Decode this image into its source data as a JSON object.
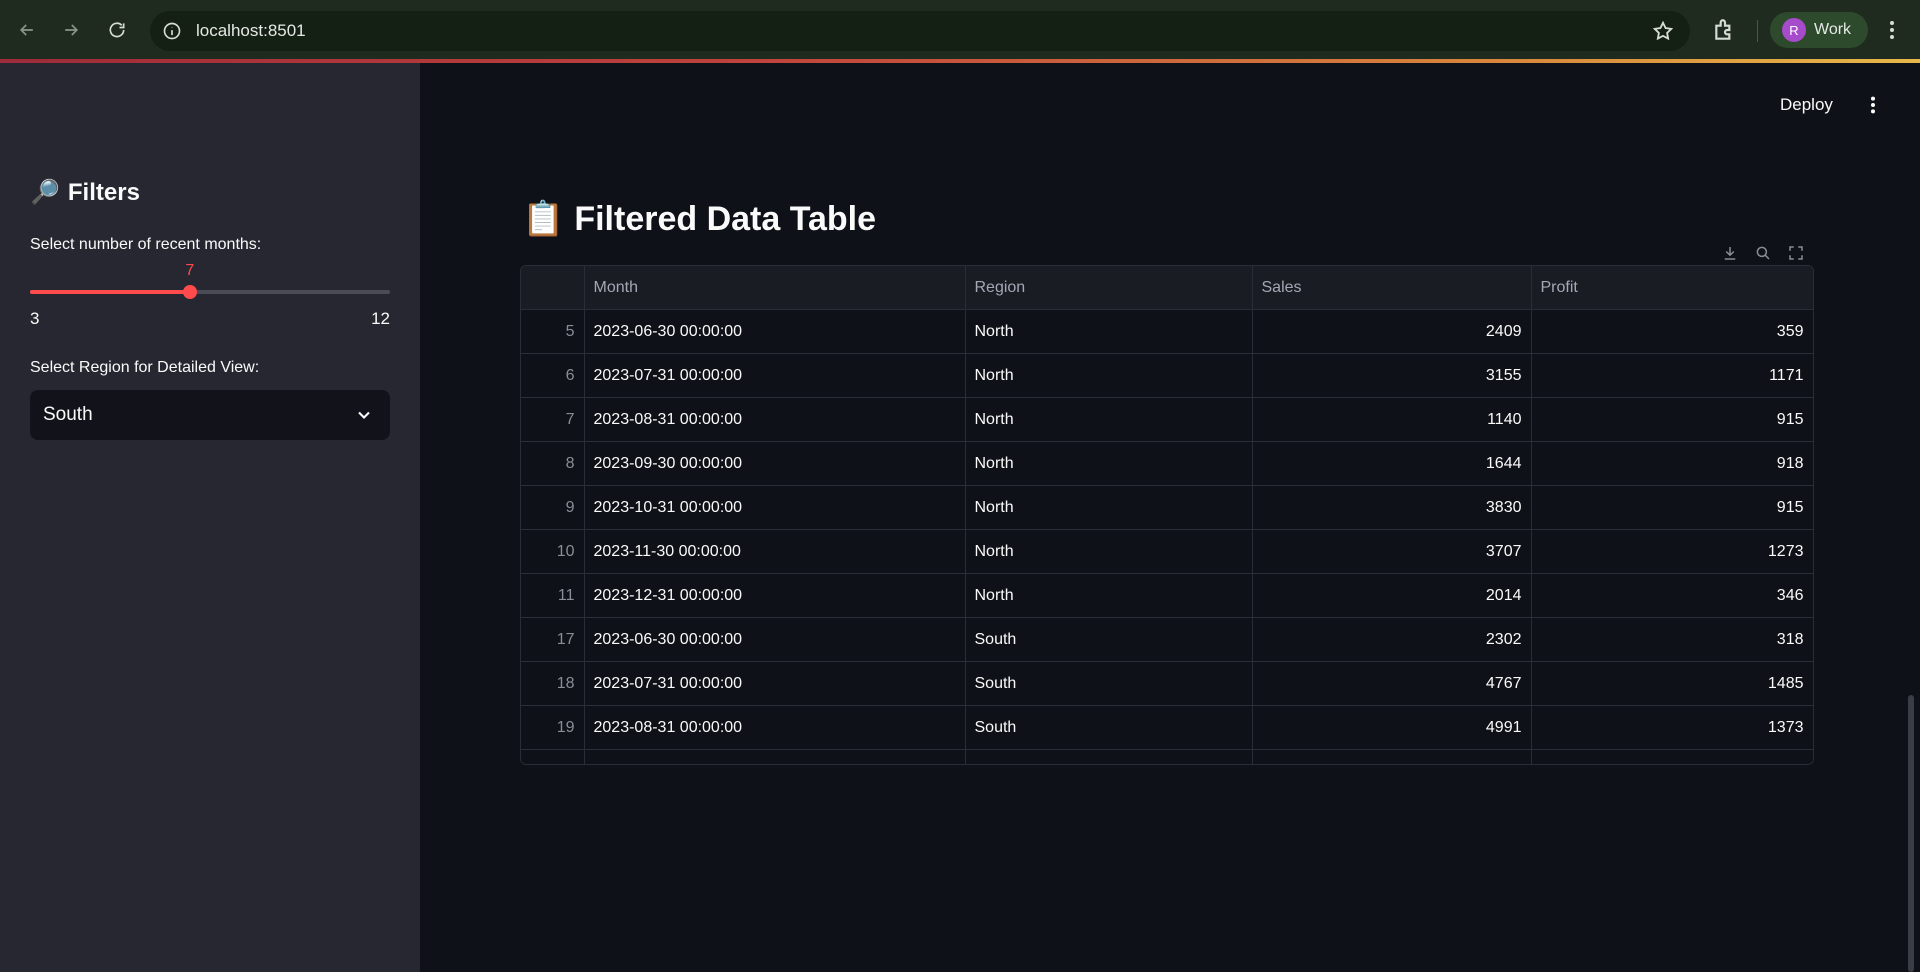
{
  "browser": {
    "url": "localhost:8501",
    "profile_initial": "R",
    "profile_name": "Work"
  },
  "sidebar": {
    "title_emoji": "🔎",
    "title": "Filters",
    "slider": {
      "label": "Select number of recent months:",
      "value": "7",
      "min": "3",
      "max": "12",
      "fraction": 0.444
    },
    "select": {
      "label": "Select Region for Detailed View:",
      "value": "South"
    }
  },
  "header": {
    "deploy_label": "Deploy"
  },
  "main": {
    "title_emoji": "📋",
    "title": "Filtered Data Table",
    "table": {
      "columns": [
        "",
        "Month",
        "Region",
        "Sales",
        "Profit"
      ],
      "rows": [
        [
          "5",
          "2023-06-30 00:00:00",
          "North",
          "2409",
          "359"
        ],
        [
          "6",
          "2023-07-31 00:00:00",
          "North",
          "3155",
          "1171"
        ],
        [
          "7",
          "2023-08-31 00:00:00",
          "North",
          "1140",
          "915"
        ],
        [
          "8",
          "2023-09-30 00:00:00",
          "North",
          "1644",
          "918"
        ],
        [
          "9",
          "2023-10-31 00:00:00",
          "North",
          "3830",
          "915"
        ],
        [
          "10",
          "2023-11-30 00:00:00",
          "North",
          "3707",
          "1273"
        ],
        [
          "11",
          "2023-12-31 00:00:00",
          "North",
          "2014",
          "346"
        ],
        [
          "17",
          "2023-06-30 00:00:00",
          "South",
          "2302",
          "318"
        ],
        [
          "18",
          "2023-07-31 00:00:00",
          "South",
          "4767",
          "1485"
        ],
        [
          "19",
          "2023-08-31 00:00:00",
          "South",
          "4991",
          "1373"
        ]
      ]
    }
  },
  "colors": {
    "accent": "#ff4b4b",
    "sidebar_bg": "#262730",
    "main_bg": "#0e1117"
  }
}
